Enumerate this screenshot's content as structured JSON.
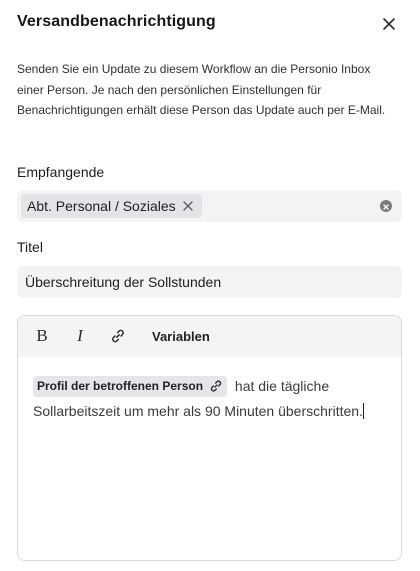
{
  "dialog": {
    "title": "Versandbenachrichtigung",
    "close_icon": "close-icon",
    "description": "Senden Sie ein Update zu diesem Workflow an die Personio Inbox einer Person. Je nach den persönlichen Einstellungen für Benachrichtigungen erhält diese Person das Update auch per E-Mail."
  },
  "recipients": {
    "label": "Empfangende",
    "chips": [
      {
        "label": "Abt. Personal / Soziales",
        "remove_icon": "close-icon"
      }
    ],
    "clear_icon": "clear-circle-icon"
  },
  "title_field": {
    "label": "Titel",
    "value": "Überschreitung der Sollstunden"
  },
  "editor": {
    "toolbar": {
      "bold_label": "B",
      "italic_label": "I",
      "link_icon": "link-icon",
      "variables_label": "Variablen"
    },
    "variable_chip": {
      "label": "Profil der betroffenen Person",
      "icon": "link-icon"
    },
    "body_text": "hat die tägliche Sollarbeitszeit um mehr als 90 Minuten überschritten."
  },
  "colors": {
    "field_background": "#f3f3f4",
    "chip_background": "#e4e4e6",
    "toolbar_background": "#f4f4f5",
    "border": "#d9d9dc",
    "text": "#1d1d1f"
  }
}
